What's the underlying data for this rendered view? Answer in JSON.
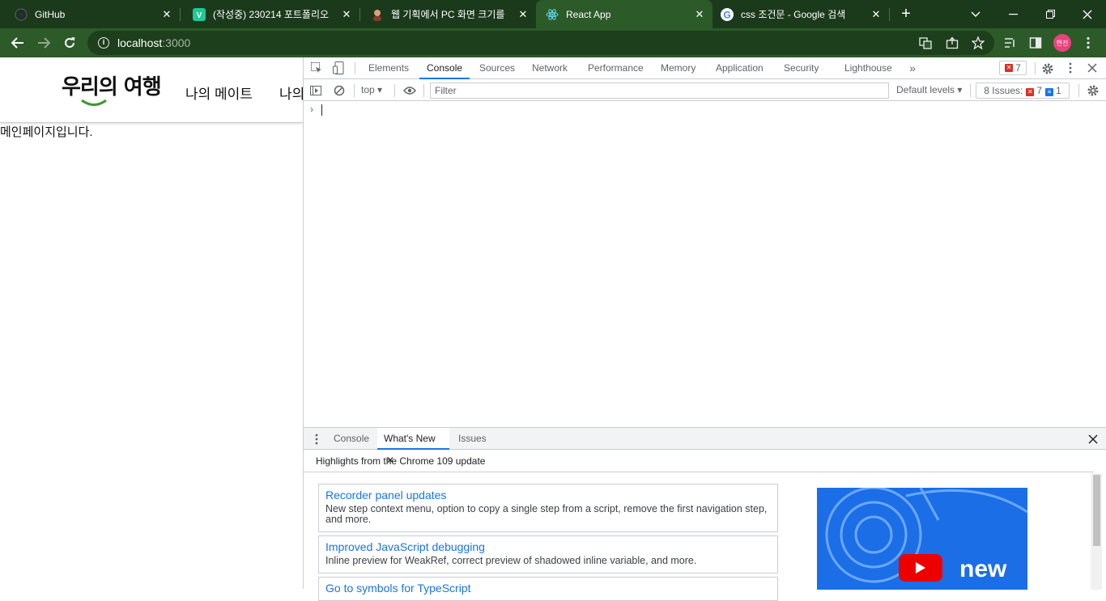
{
  "browser": {
    "tabs": [
      {
        "title": "GitHub",
        "icon": "github-icon"
      },
      {
        "title": "(작성중) 230214 포트폴리오",
        "icon": "velog-icon"
      },
      {
        "title": "웹 기획에서 PC 화면 크기를",
        "icon": "avatar-favicon-icon"
      },
      {
        "title": "React App",
        "icon": "react-icon",
        "active": true
      },
      {
        "title": "css 조건문 - Google 검색",
        "icon": "google-icon"
      }
    ],
    "address": {
      "host": "localhost",
      "port": ":3000"
    },
    "profile_initials": "현진",
    "colors": {
      "frame": "#1b3a1b",
      "toolbar": "#2c5a29",
      "omnibox": "#1d3f1b",
      "avatar": "#e8437d"
    }
  },
  "page": {
    "logo_text": "우리의 여행",
    "nav": [
      "나의 메이트",
      "나의"
    ],
    "main_text": "메인페이지입니다."
  },
  "devtools": {
    "tabs": [
      "Elements",
      "Console",
      "Sources",
      "Network",
      "Performance",
      "Memory",
      "Application",
      "Security",
      "Lighthouse"
    ],
    "active_tab": "Console",
    "error_count": "7",
    "context": "top",
    "filter_placeholder": "Filter",
    "levels": "Default levels",
    "issues_label": "8 Issues:",
    "issues_errors": "7",
    "issues_info": "1",
    "drawer": {
      "tabs": [
        "Console",
        "What's New",
        "Issues"
      ],
      "active_tab": "What's New",
      "highlights": "Highlights from the Chrome 109 update",
      "cards": [
        {
          "title": "Recorder panel updates",
          "desc": "New step context menu, option to copy a single step from a script, remove the first navigation step, and more."
        },
        {
          "title": "Improved JavaScript debugging",
          "desc": "Inline preview for WeakRef, correct preview of shadowed inline variable, and more."
        },
        {
          "title": "Go to symbols for TypeScript",
          "desc": ""
        }
      ],
      "promo_text": "new"
    }
  }
}
